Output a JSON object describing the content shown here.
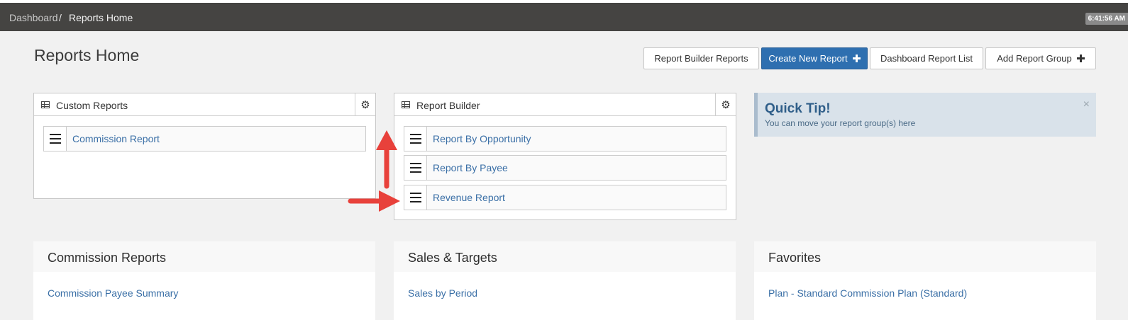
{
  "breadcrumb": {
    "home": "Dashboard",
    "separator": "/",
    "current": "Reports Home"
  },
  "clock": "6:41:56 AM",
  "page_title": "Reports Home",
  "toolbar": {
    "report_builder_reports": "Report Builder Reports",
    "create_new_report": "Create New Report",
    "dashboard_report_list": "Dashboard Report List",
    "add_report_group": "Add Report Group"
  },
  "panels": {
    "custom_reports": {
      "title": "Custom Reports",
      "items": [
        "Commission Report"
      ]
    },
    "report_builder": {
      "title": "Report Builder",
      "items": [
        "Report By Opportunity",
        "Report By Payee",
        "Revenue Report"
      ]
    }
  },
  "quick_tip": {
    "title": "Quick Tip!",
    "text": "You can move your report group(s) here",
    "close": "×"
  },
  "groups": [
    {
      "title": "Commission Reports",
      "link": "Commission Payee Summary"
    },
    {
      "title": "Sales & Targets",
      "link": "Sales by Period"
    },
    {
      "title": "Favorites",
      "link": "Plan - Standard Commission Plan (Standard)"
    }
  ],
  "colors": {
    "accent": "#2e6fb0",
    "link": "#3a6fa6",
    "annotation_arrow": "#e8413b",
    "topbar": "#454442"
  }
}
